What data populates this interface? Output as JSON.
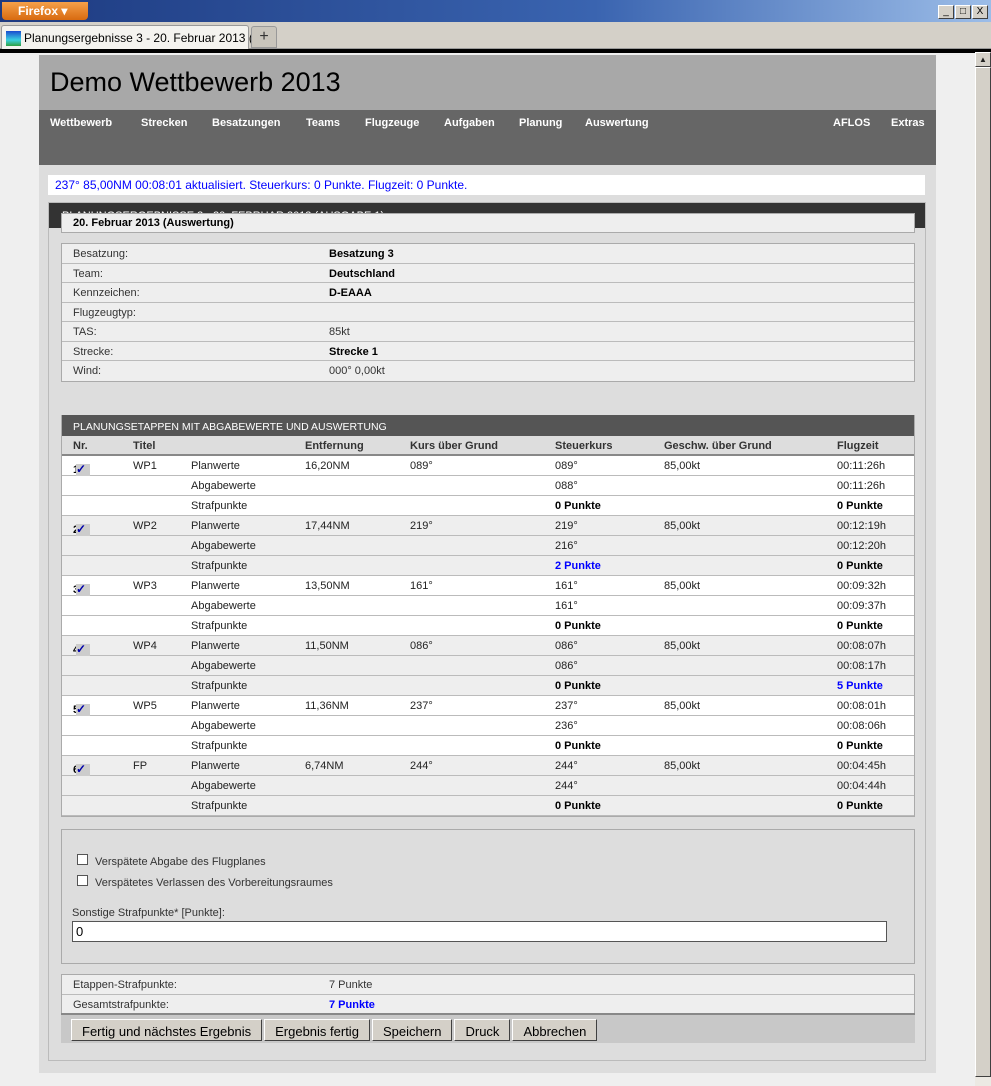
{
  "browser": {
    "menu": "Firefox",
    "tab_title": "Planungsergebnisse 3 - 20. Februar 2013 (A...",
    "new_tab": "+",
    "minimize": "_",
    "maximize": "□",
    "close": "X"
  },
  "header": {
    "title": "Demo Wettbewerb 2013"
  },
  "nav": [
    "Wettbewerb",
    "Strecken",
    "Besatzungen",
    "Teams",
    "Flugzeuge",
    "Aufgaben",
    "Planung",
    "Auswertung",
    "AFLOS",
    "Extras"
  ],
  "message": "237° 85,00NM 00:08:01 aktualisiert. Steuerkurs: 0 Punkte. Flugzeit: 0 Punkte.",
  "panel": {
    "title": "PLANUNGSERGEBNISSE 3 - 20. FEBRUAR 2013 (AUSGABE 1)",
    "date": "20. Februar 2013 (Auswertung)"
  },
  "info": [
    {
      "label": "Besatzung:",
      "value": "Besatzung 3",
      "bold": true
    },
    {
      "label": "Team:",
      "value": "Deutschland",
      "bold": true
    },
    {
      "label": "Kennzeichen:",
      "value": "D-EAAA",
      "bold": true
    },
    {
      "label": "Flugzeugtyp:",
      "value": "",
      "bold": false
    },
    {
      "label": "TAS:",
      "value": "85kt",
      "bold": false
    },
    {
      "label": "Strecke:",
      "value": "Strecke 1",
      "bold": true
    },
    {
      "label": "Wind:",
      "value": "000° 0,00kt",
      "bold": false
    }
  ],
  "legs": {
    "title": "PLANUNGSETAPPEN MIT ABGABEWERTE UND AUSWERTUNG",
    "columns": [
      "Nr.",
      "Titel",
      "",
      "Entfernung",
      "Kurs über Grund",
      "Steuerkurs",
      "Geschw. über Grund",
      "Flugzeit"
    ],
    "row_labels": [
      "Planwerte",
      "Abgabewerte",
      "Strafpunkte"
    ],
    "rows": [
      {
        "nr": "1",
        "title": "WP1",
        "dist": "16,20NM",
        "track": "089°",
        "plan_hdg": "089°",
        "speed": "85,00kt",
        "plan_time": "00:11:26h",
        "given_hdg": "088°",
        "given_time": "00:11:26h",
        "pen_hdg": "0 Punkte",
        "pen_time": "0 Punkte"
      },
      {
        "nr": "2",
        "title": "WP2",
        "dist": "17,44NM",
        "track": "219°",
        "plan_hdg": "219°",
        "speed": "85,00kt",
        "plan_time": "00:12:19h",
        "given_hdg": "216°",
        "given_time": "00:12:20h",
        "pen_hdg": "2 Punkte",
        "pen_time": "0 Punkte"
      },
      {
        "nr": "3",
        "title": "WP3",
        "dist": "13,50NM",
        "track": "161°",
        "plan_hdg": "161°",
        "speed": "85,00kt",
        "plan_time": "00:09:32h",
        "given_hdg": "161°",
        "given_time": "00:09:37h",
        "pen_hdg": "0 Punkte",
        "pen_time": "0 Punkte"
      },
      {
        "nr": "4",
        "title": "WP4",
        "dist": "11,50NM",
        "track": "086°",
        "plan_hdg": "086°",
        "speed": "85,00kt",
        "plan_time": "00:08:07h",
        "given_hdg": "086°",
        "given_time": "00:08:17h",
        "pen_hdg": "0 Punkte",
        "pen_time": "5 Punkte"
      },
      {
        "nr": "5",
        "title": "WP5",
        "dist": "11,36NM",
        "track": "237°",
        "plan_hdg": "237°",
        "speed": "85,00kt",
        "plan_time": "00:08:01h",
        "given_hdg": "236°",
        "given_time": "00:08:06h",
        "pen_hdg": "0 Punkte",
        "pen_time": "0 Punkte"
      },
      {
        "nr": "6",
        "title": "FP",
        "dist": "6,74NM",
        "track": "244°",
        "plan_hdg": "244°",
        "speed": "85,00kt",
        "plan_time": "00:04:45h",
        "given_hdg": "244°",
        "given_time": "00:04:44h",
        "pen_hdg": "0 Punkte",
        "pen_time": "0 Punkte"
      }
    ]
  },
  "options": {
    "late_plan": "Verspätete Abgabe des Flugplanes",
    "late_exit": "Verspätetes Verlassen des Vorbereitungsraumes",
    "other_label": "Sonstige Strafpunkte* [Punkte]:",
    "other_value": "0"
  },
  "summary": {
    "leg_label": "Etappen-Strafpunkte:",
    "leg_value": "7 Punkte",
    "total_label": "Gesamtstrafpunkte:",
    "total_value": "7 Punkte"
  },
  "buttons": [
    "Fertig und nächstes Ergebnis",
    "Ergebnis fertig",
    "Speichern",
    "Druck",
    "Abbrechen"
  ],
  "colors": {
    "penalty": "#0000ff",
    "nav": "#666666",
    "header": "#a8a8a8"
  }
}
